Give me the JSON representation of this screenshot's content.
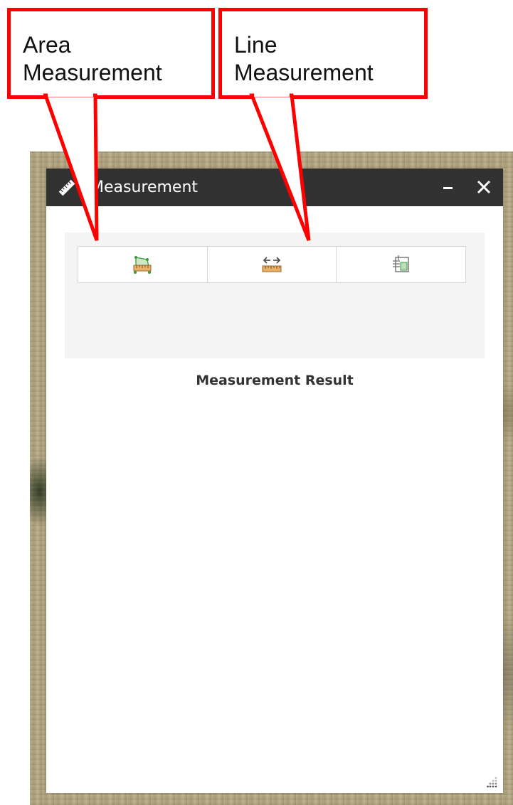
{
  "callouts": {
    "area": "Area\nMeasurement",
    "line": "Line\nMeasurement"
  },
  "widget": {
    "title": "Measurement",
    "minimize_icon": "minimize-icon",
    "close_icon": "close-icon",
    "tools": [
      {
        "name": "area-tool",
        "icon": "area-ruler-icon"
      },
      {
        "name": "distance-tool",
        "icon": "distance-ruler-icon"
      },
      {
        "name": "location-tool",
        "icon": "location-grid-icon"
      }
    ],
    "result_label": "Measurement Result"
  },
  "colors": {
    "callout_border": "#ff0000",
    "titlebar": "#313131",
    "tool_area": "#f4f4f4"
  }
}
